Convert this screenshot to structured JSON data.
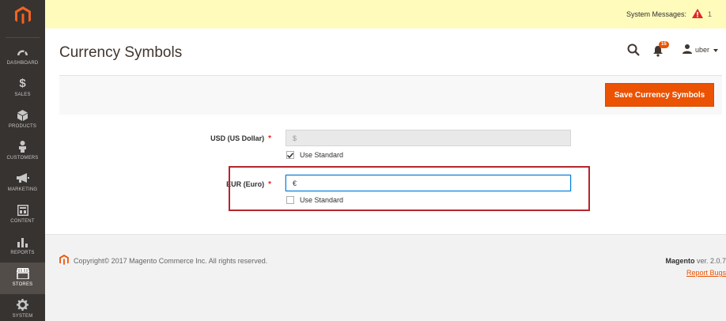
{
  "sidebar": {
    "items": [
      {
        "label": "DASHBOARD",
        "icon": "dashboard-icon"
      },
      {
        "label": "SALES",
        "icon": "dollar-icon"
      },
      {
        "label": "PRODUCTS",
        "icon": "cube-icon"
      },
      {
        "label": "CUSTOMERS",
        "icon": "person-icon"
      },
      {
        "label": "MARKETING",
        "icon": "megaphone-icon"
      },
      {
        "label": "CONTENT",
        "icon": "layout-icon"
      },
      {
        "label": "REPORTS",
        "icon": "bar-chart-icon"
      },
      {
        "label": "STORES",
        "icon": "store-icon",
        "active": true
      },
      {
        "label": "SYSTEM",
        "icon": "gear-icon"
      }
    ]
  },
  "system_messages": {
    "label": "System Messages:",
    "count": "1"
  },
  "header": {
    "title": "Currency Symbols",
    "notifications_count": "15",
    "username": "uber"
  },
  "actions": {
    "save_label": "Save Currency Symbols"
  },
  "form": {
    "usd": {
      "label": "USD (US Dollar)",
      "value": "$",
      "use_standard_label": "Use Standard",
      "use_standard_checked": true
    },
    "eur": {
      "label": "EUR (Euro)",
      "value": "€",
      "use_standard_label": "Use Standard",
      "use_standard_checked": false
    },
    "required_mark": "*"
  },
  "footer": {
    "copyright": "Copyright© 2017 Magento Commerce Inc. All rights reserved.",
    "brand": "Magento",
    "version_text": " ver. 2.0.7",
    "report_bugs": "Report Bugs"
  },
  "colors": {
    "accent": "#eb5202",
    "sidebar": "#373330",
    "highlight": "#b3262c",
    "notice": "#fffbbb"
  }
}
